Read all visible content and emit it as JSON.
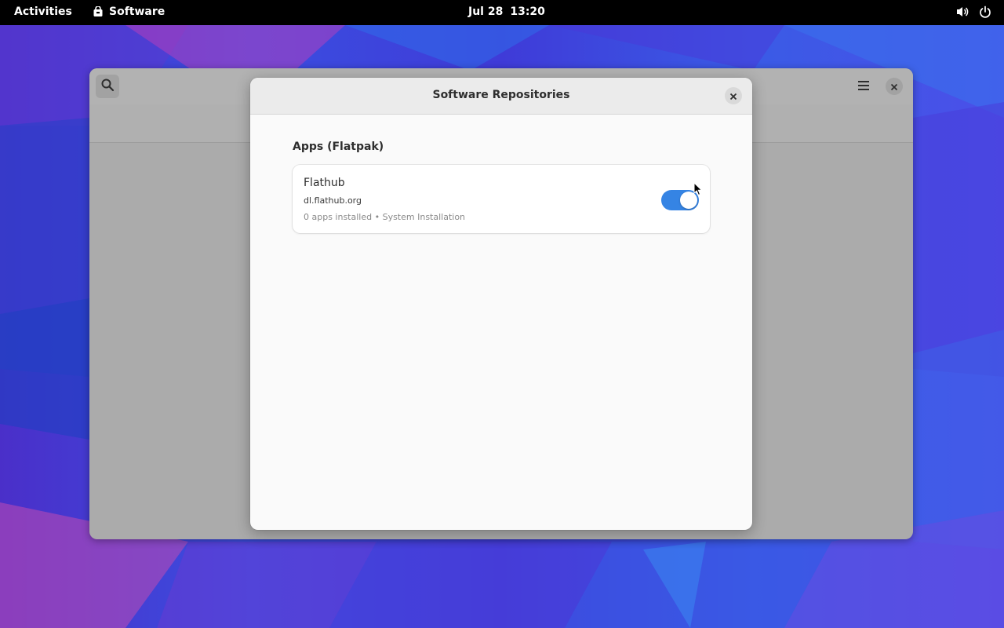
{
  "topbar": {
    "activities_label": "Activities",
    "app_name": "Software",
    "date": "Jul 28",
    "time": "13:20",
    "icons": [
      "bag-icon",
      "volume-icon",
      "power-icon"
    ]
  },
  "main_window": {
    "icons": [
      "search-icon",
      "hamburger-menu-icon",
      "close-icon"
    ]
  },
  "dialog": {
    "title": "Software Repositories",
    "close_icon": "close-icon",
    "section_title": "Apps (Flatpak)",
    "repositories": [
      {
        "name": "Flathub",
        "url": "dl.flathub.org",
        "details": "0 apps installed • System Installation",
        "enabled": true
      }
    ]
  },
  "colors": {
    "accent": "#3584e4",
    "topbar": "#000000",
    "dialog_bg": "#fafafa",
    "dialog_header": "#ebebeb",
    "dimmed_window": "#ababab"
  }
}
